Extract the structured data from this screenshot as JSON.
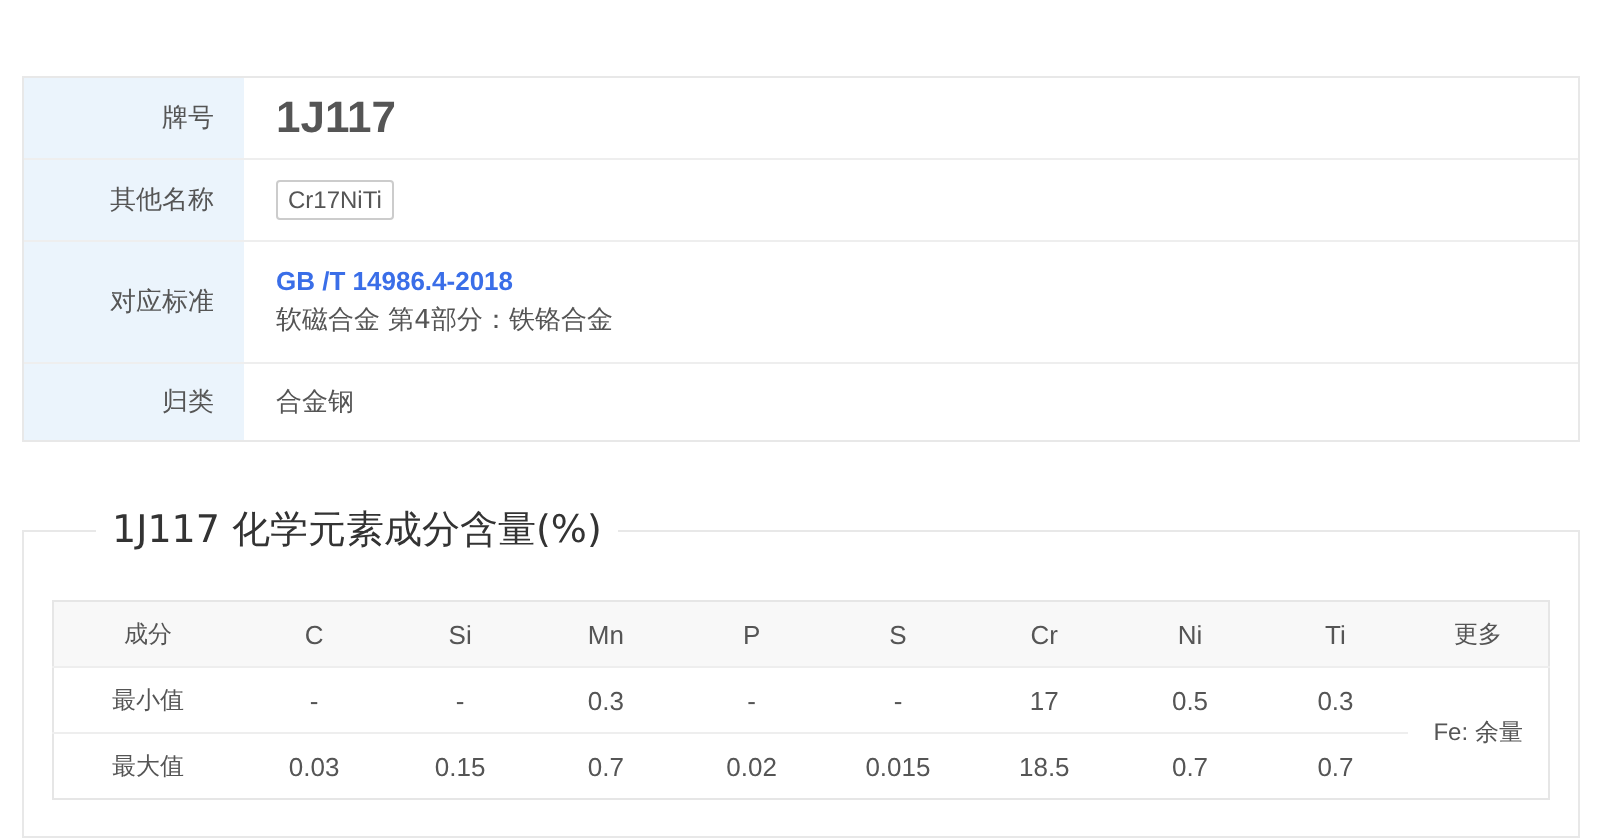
{
  "info": {
    "rows": [
      {
        "kind": "grade",
        "label": "牌号",
        "value": "1J117"
      },
      {
        "kind": "tags",
        "label": "其他名称",
        "tags": [
          "Cr17NiTi"
        ]
      },
      {
        "kind": "standard",
        "label": "对应标准",
        "code": "GB /T 14986.4-2018",
        "title": "软磁合金 第4部分：铁铬合金"
      },
      {
        "kind": "text",
        "label": "归类",
        "value": "合金钢"
      }
    ]
  },
  "composition": {
    "title": "1J117 化学元素成分含量(%)",
    "header": [
      "成分",
      "C",
      "Si",
      "Mn",
      "P",
      "S",
      "Cr",
      "Ni",
      "Ti",
      "更多"
    ],
    "rows": [
      {
        "label": "最小值",
        "values": [
          "-",
          "-",
          "0.3",
          "-",
          "-",
          "17",
          "0.5",
          "0.3"
        ]
      },
      {
        "label": "最大值",
        "values": [
          "0.03",
          "0.15",
          "0.7",
          "0.02",
          "0.015",
          "18.5",
          "0.7",
          "0.7"
        ]
      }
    ],
    "more": "Fe: 余量"
  }
}
